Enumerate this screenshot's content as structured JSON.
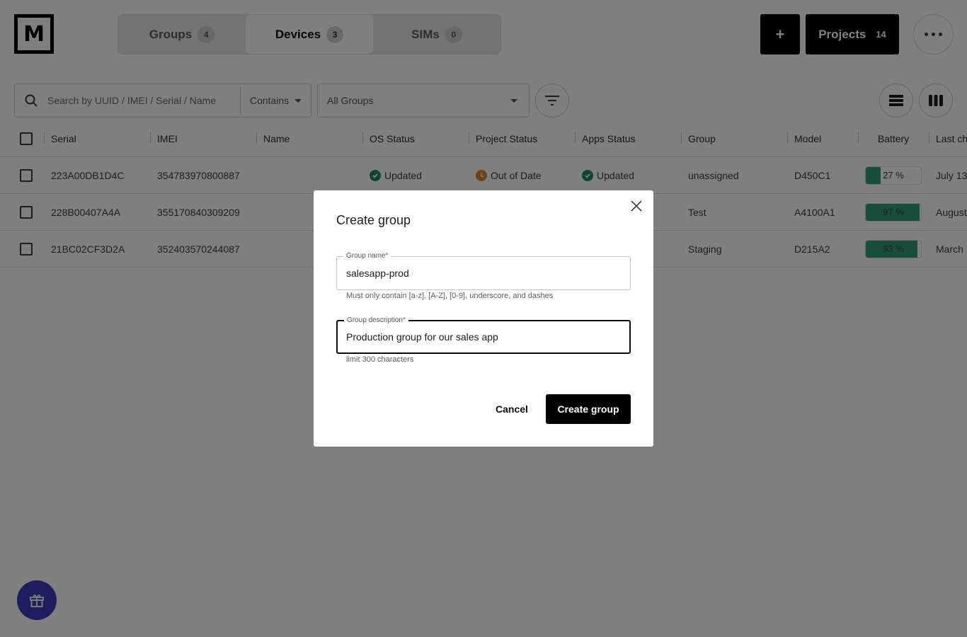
{
  "header": {
    "logo_letter": "M",
    "tabs": [
      {
        "label": "Groups",
        "count": "4",
        "active": false
      },
      {
        "label": "Devices",
        "count": "3",
        "active": true
      },
      {
        "label": "SIMs",
        "count": "0",
        "active": false
      }
    ],
    "add_button_label": "+",
    "projects_button": {
      "label": "Projects",
      "count": "14"
    }
  },
  "filters": {
    "search_placeholder": "Search by UUID / IMEI / Serial / Name",
    "search_value": "",
    "match_mode": "Contains",
    "group_filter": "All Groups"
  },
  "table": {
    "columns": [
      "Serial",
      "IMEI",
      "Name",
      "OS Status",
      "Project Status",
      "Apps Status",
      "Group",
      "Model",
      "Battery",
      "Last ch"
    ],
    "rows": [
      {
        "serial": "223A00DB1D4C",
        "imei": "354783970800887",
        "name": "",
        "os_status": "Updated",
        "project_status": "Out of Date",
        "apps_status": "Updated",
        "group": "unassigned",
        "model": "D450C1",
        "battery_percent": 27,
        "battery_label": "27 %",
        "last_checkin": "July 13,"
      },
      {
        "serial": "228B00407A4A",
        "imei": "355170840309209",
        "name": "",
        "os_status": "",
        "project_status": "",
        "apps_status": "",
        "group": "Test",
        "model": "A4100A1",
        "battery_percent": 97,
        "battery_label": "97 %",
        "last_checkin": "August"
      },
      {
        "serial": "21BC02CF3D2A",
        "imei": "352403570244087",
        "name": "",
        "os_status": "",
        "project_status": "",
        "apps_status": "",
        "group": "Staging",
        "model": "D215A2",
        "battery_percent": 93,
        "battery_label": "93 %",
        "last_checkin": "March 1"
      }
    ]
  },
  "status_colors": {
    "updated": "#1f8a5f",
    "out_of_date": "#d9822b",
    "battery": "#2f9e78"
  },
  "modal": {
    "title": "Create group",
    "group_name": {
      "label": "Group name",
      "required_mark": "*",
      "value": "salesapp-prod",
      "helper": "Must only contain [a-z], [A-Z], [0-9], underscore, and dashes"
    },
    "group_description": {
      "label": "Group description",
      "required_mark": "*",
      "value": "Production group for our sales app",
      "helper": "limit 300 characters"
    },
    "cancel_label": "Cancel",
    "submit_label": "Create group"
  }
}
